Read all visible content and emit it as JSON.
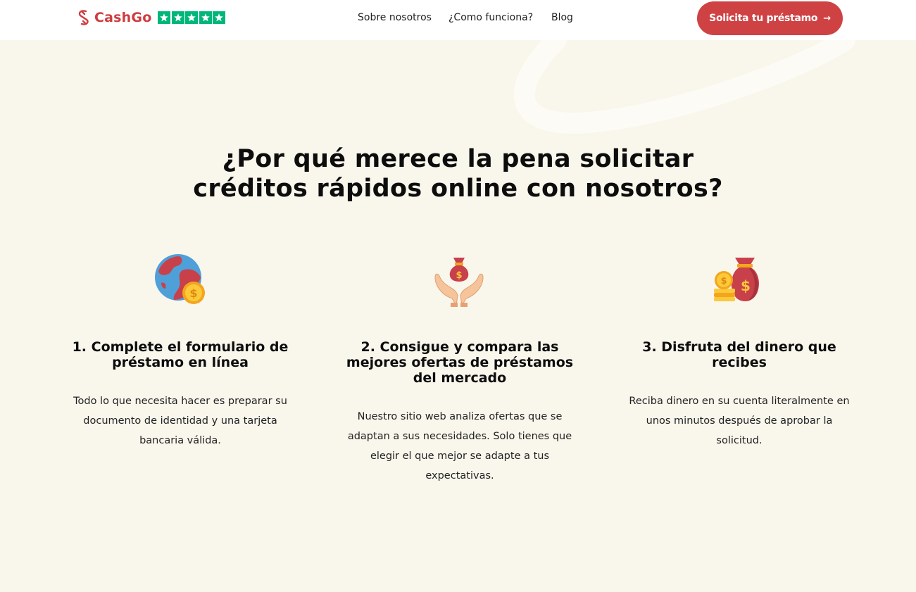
{
  "header": {
    "brand": "CashGo",
    "rating_stars": 5,
    "nav": [
      "Sobre nosotros",
      "¿Como funciona?",
      "Blog"
    ],
    "cta_label": "Solicita tu préstamo",
    "cta_arrow": "→"
  },
  "colors": {
    "brand_red": "#cf4244",
    "trustpilot_green": "#00b67a",
    "page_background": "#f9f6ec"
  },
  "hero": {
    "title_line1": "¿Por qué merece la pena solicitar",
    "title_line2": "créditos rápidos online con nosotros?"
  },
  "steps": [
    {
      "icon": "globe-coin-icon",
      "title": "1. Complete el formulario de préstamo en línea",
      "text": "Todo lo que necesita hacer es preparar su documento de identidad y una tarjeta bancaria válida."
    },
    {
      "icon": "hands-money-bag-icon",
      "title": "2. Consigue y compara las mejores ofertas de préstamos del mercado",
      "text": "Nuestro sitio web analiza ofertas que se adaptan a sus necesidades. Solo tienes que elegir el que mejor se adapte a tus expectativas."
    },
    {
      "icon": "money-bag-coins-icon",
      "title": "3. Disfruta del dinero que recibes",
      "text": "Reciba dinero en su cuenta literalmente en unos minutos después de aprobar la solicitud."
    }
  ]
}
